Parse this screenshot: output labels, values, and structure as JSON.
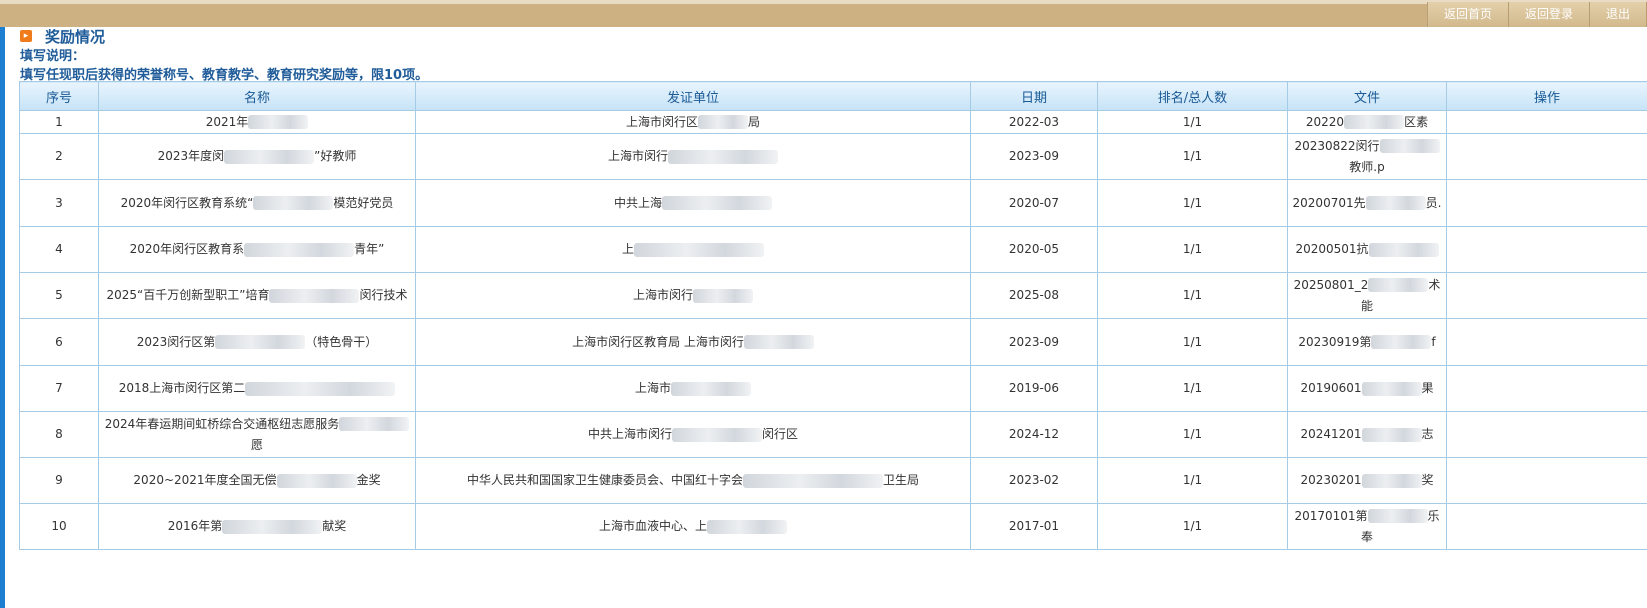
{
  "header": {
    "nav": [
      {
        "label": "返回首页"
      },
      {
        "label": "返回登录"
      },
      {
        "label": "退出"
      }
    ]
  },
  "section": {
    "title": "奖励情况",
    "note_label": "填写说明：",
    "note_text": "填写任现职后获得的荣誉称号、教育教学、教育研究奖励等，限10项。"
  },
  "table": {
    "columns": [
      "序号",
      "名称",
      "发证单位",
      "日期",
      "排名/总人数",
      "文件",
      "操作"
    ],
    "rows": [
      {
        "no": "1",
        "name": "2021年",
        "unit": "上海市闵行区",
        "unit_tail": "局",
        "date": "2022-03",
        "rank": "1/1",
        "file": "20220",
        "file_tail": "区素"
      },
      {
        "no": "2",
        "name": "2023年度闵",
        "name_tail": "”好教师",
        "unit": "上海市闵行",
        "unit_tail": "",
        "date": "2023-09",
        "rank": "1/1",
        "file": "20230822闵行",
        "file_tail": "教师.p"
      },
      {
        "no": "3",
        "name": "2020年闵行区教育系统“",
        "name_tail": "模范好党员",
        "unit": "中共上海",
        "unit_tail": "",
        "date": "2020-07",
        "rank": "1/1",
        "file": "20200701先",
        "file_tail": "员."
      },
      {
        "no": "4",
        "name": "2020年闵行区教育系",
        "name_tail": "青年”",
        "unit": "上",
        "unit_tail": "",
        "date": "2020-05",
        "rank": "1/1",
        "file": "20200501抗",
        "file_tail": ""
      },
      {
        "no": "5",
        "name": "2025“百千万创新型职工”培育",
        "name_tail": "闵行技术",
        "unit": "上海市闵行",
        "unit_tail": "",
        "date": "2025-08",
        "rank": "1/1",
        "file": "20250801_2",
        "file_tail": "术能"
      },
      {
        "no": "6",
        "name": "2023闵行区第",
        "name_tail": "（特色骨干）",
        "unit": "上海市闵行区教育局 上海市闵行",
        "unit_tail": "",
        "date": "2023-09",
        "rank": "1/1",
        "file": "20230919第",
        "file_tail": "f"
      },
      {
        "no": "7",
        "name": "2018上海市闵行区第二",
        "name_tail": "",
        "unit": "上海市",
        "unit_tail": "",
        "date": "2019-06",
        "rank": "1/1",
        "file": "20190601",
        "file_tail": "果"
      },
      {
        "no": "8",
        "name": "2024年春运期间虹桥综合交通枢纽志愿服务",
        "name_tail": "愿",
        "unit": "中共上海市闵行",
        "unit_tail": "闵行区",
        "date": "2024-12",
        "rank": "1/1",
        "file": "20241201",
        "file_tail": "志"
      },
      {
        "no": "9",
        "name": "2020~2021年度全国无偿",
        "name_tail": "金奖",
        "unit": "中华人民共和国国家卫生健康委员会、中国红十字会",
        "unit_tail": "卫生局",
        "date": "2023-02",
        "rank": "1/1",
        "file": "20230201",
        "file_tail": "奖"
      },
      {
        "no": "10",
        "name": "2016年第",
        "name_tail": "献奖",
        "unit": "上海市血液中心、上",
        "unit_tail": "",
        "date": "2017-01",
        "rank": "1/1",
        "file": "20170101第",
        "file_tail": "乐奉"
      }
    ]
  }
}
